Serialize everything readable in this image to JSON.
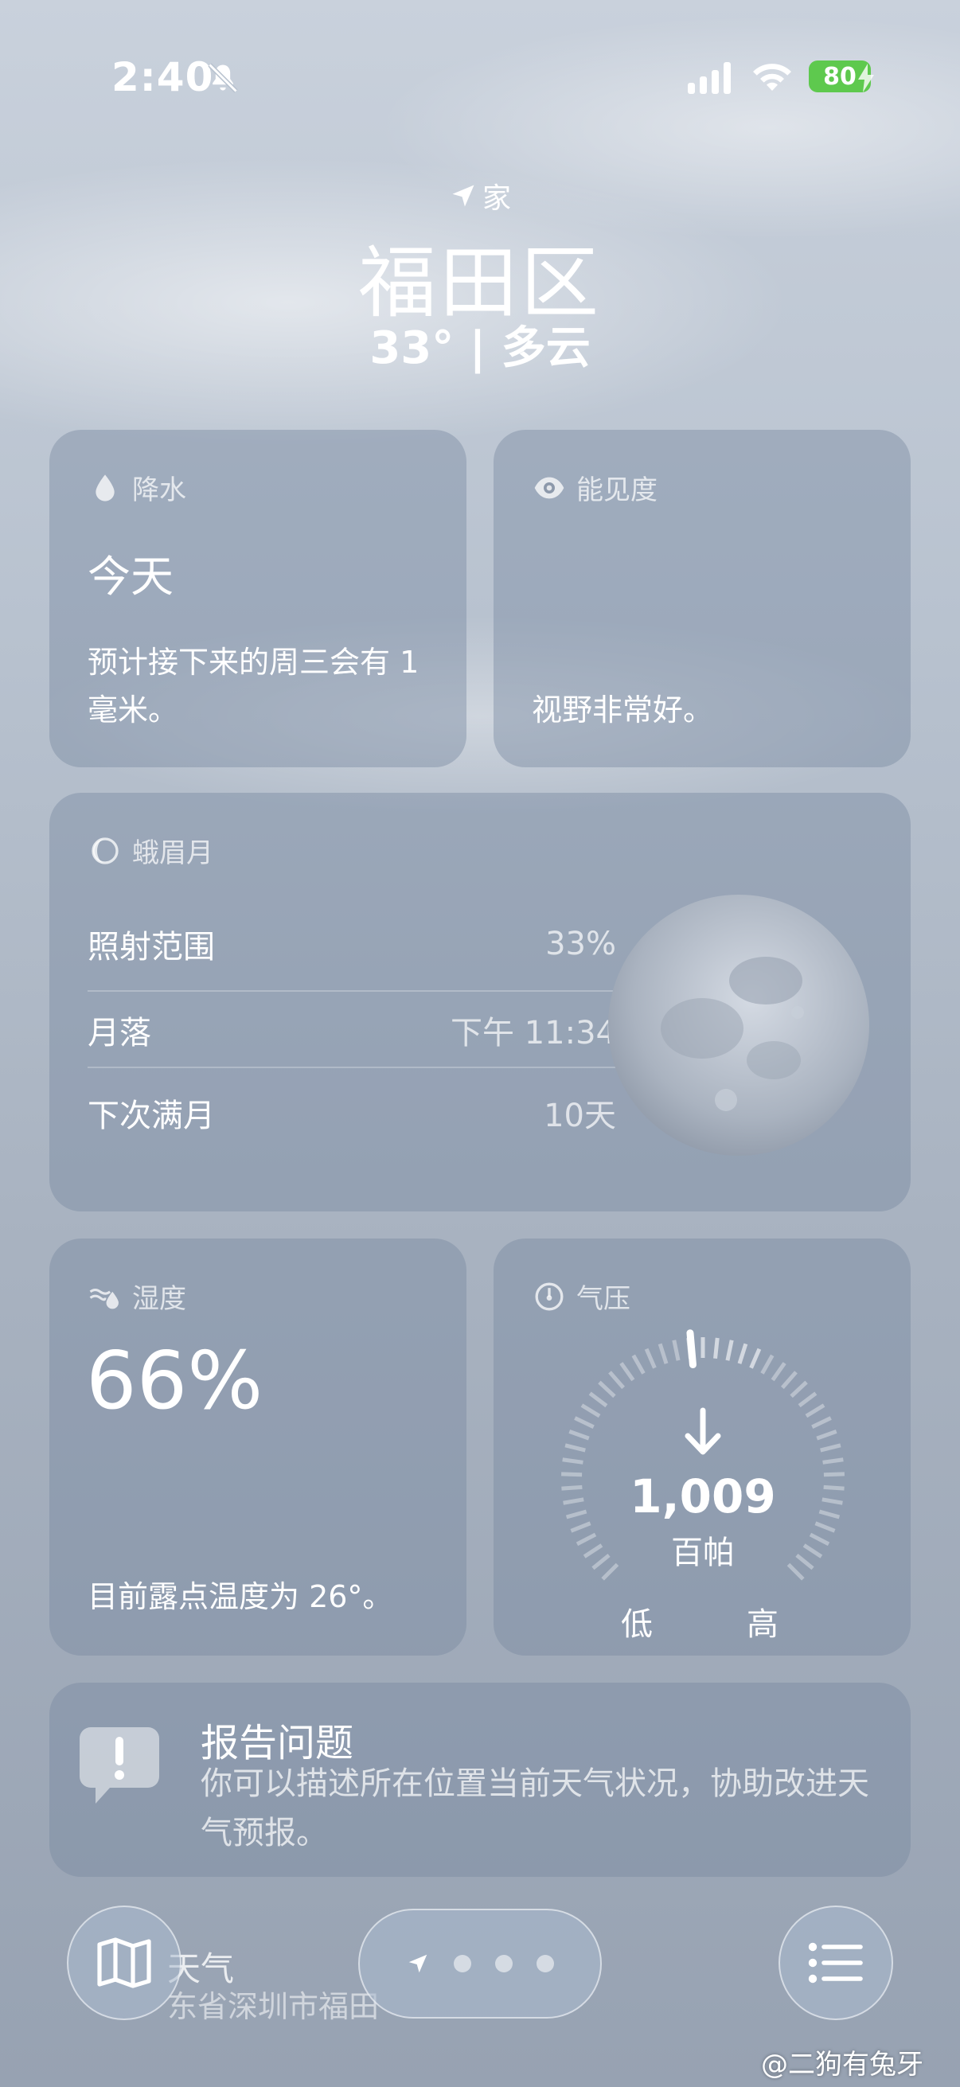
{
  "status_bar": {
    "time": "2:40",
    "battery": "80"
  },
  "header": {
    "location_tag": "家",
    "city": "福田区",
    "condition": "33° | 多云"
  },
  "precipitation": {
    "title": "降水",
    "label": "今天",
    "description": "预计接下来的周三会有 1 毫米。"
  },
  "visibility": {
    "title": "能见度",
    "description": "视野非常好。"
  },
  "moon": {
    "title": "蛾眉月",
    "rows": [
      {
        "label": "照射范围",
        "value": "33%"
      },
      {
        "label": "月落",
        "value": "下午 11:34"
      },
      {
        "label": "下次满月",
        "value": "10天"
      }
    ]
  },
  "humidity": {
    "title": "湿度",
    "value": "66%",
    "description": "目前露点温度为 26°。"
  },
  "pressure": {
    "title": "气压",
    "value": "1,009",
    "unit": "百帕",
    "low": "低",
    "high": "高"
  },
  "report": {
    "title": "报告问题",
    "description": "你可以描述所在位置当前天气状况，协助改进天气预报。"
  },
  "bottom": {
    "ghost_title": "天气",
    "ghost_sub": "东省深圳市福田"
  },
  "watermark": "@二狗有兔牙",
  "colors": {
    "battery": "#5ec94e"
  },
  "icons": [
    "location-arrow-icon",
    "bell-slash-icon",
    "wifi-icon",
    "raindrop-icon",
    "eye-icon",
    "moon-phase-icon",
    "humidity-icon",
    "gauge-icon",
    "exclamation-bubble-icon",
    "map-icon",
    "list-icon"
  ]
}
